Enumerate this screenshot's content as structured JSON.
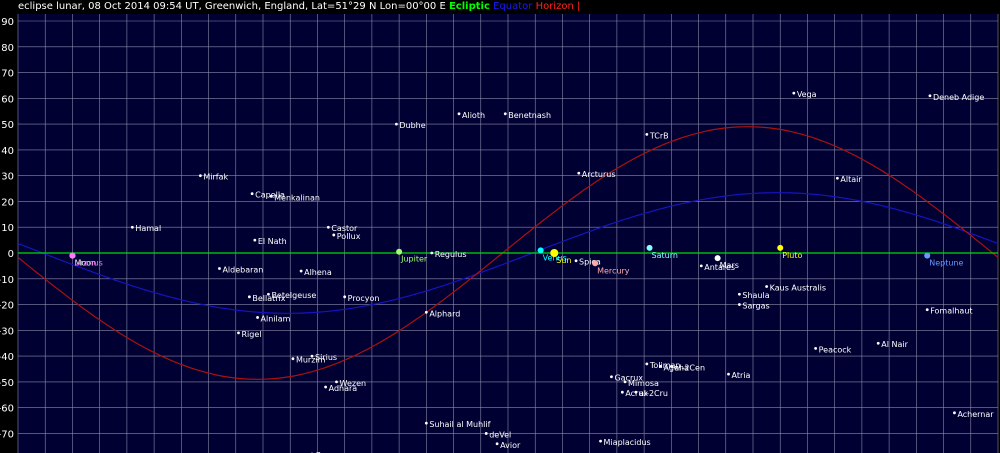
{
  "title": "eclipse lunar, 08 Oct 2014 09:54 UT, Greenwich, England, Lat=51°29 N Lon=00°00 E",
  "legend": {
    "ecliptic": "Ecliptic",
    "equator": "Equator",
    "horizon": "Horizon",
    "separator": "|"
  },
  "colors": {
    "background": "#000033",
    "grid": "#8a8aa8",
    "ecliptic": "#00dd00",
    "equator": "#1515c0",
    "horizon": "#aa1111",
    "star": "#ffffff"
  },
  "chart_data": {
    "type": "scatter",
    "y_ticks": [
      "90",
      "80",
      "70",
      "60",
      "50",
      "40",
      "30",
      "20",
      "10",
      "0",
      "-10",
      "-20",
      "-30",
      "-40",
      "-50",
      "-60",
      "-70"
    ],
    "ylim": [
      -80,
      90
    ],
    "xlim": [
      0,
      360
    ],
    "grid": true,
    "bodies": [
      {
        "name": "Moon",
        "x": 20,
        "y": -1,
        "color": "#ffffff"
      },
      {
        "name": "Uranus",
        "x": 20,
        "y": -1,
        "color": "#ff77ff"
      },
      {
        "name": "Jupiter",
        "x": 140,
        "y": 0.5,
        "color": "#a0ff70"
      },
      {
        "name": "Venus",
        "x": 192,
        "y": 1,
        "color": "#00ffff"
      },
      {
        "name": "Sun",
        "x": 197,
        "y": 0,
        "color": "#ffff00"
      },
      {
        "name": "Mercury",
        "x": 212,
        "y": -4,
        "color": "#ffaaaa"
      },
      {
        "name": "Saturn",
        "x": 232,
        "y": 2,
        "color": "#80ffff"
      },
      {
        "name": "Mars",
        "x": 257,
        "y": -2,
        "color": "#ffffff"
      },
      {
        "name": "Pluto",
        "x": 280,
        "y": 2,
        "color": "#ffff00"
      },
      {
        "name": "Neptune",
        "x": 334,
        "y": -1,
        "color": "#6699ff"
      }
    ],
    "stars": [
      {
        "name": "Hamal",
        "x": 42,
        "y": 10
      },
      {
        "name": "Mirfak",
        "x": 67,
        "y": 30
      },
      {
        "name": "Capella",
        "x": 86,
        "y": 23
      },
      {
        "name": "Menkalinan",
        "x": 93,
        "y": 22
      },
      {
        "name": "El Nath",
        "x": 87,
        "y": 5
      },
      {
        "name": "Aldebaran",
        "x": 74,
        "y": -6
      },
      {
        "name": "Alhena",
        "x": 104,
        "y": -7
      },
      {
        "name": "Castor",
        "x": 114,
        "y": 10
      },
      {
        "name": "Pollux",
        "x": 116,
        "y": 7
      },
      {
        "name": "Bellatrix",
        "x": 85,
        "y": -17
      },
      {
        "name": "Betelgeuse",
        "x": 92,
        "y": -16
      },
      {
        "name": "Alnilam",
        "x": 88,
        "y": -25
      },
      {
        "name": "Procyon",
        "x": 120,
        "y": -17
      },
      {
        "name": "Rigel",
        "x": 81,
        "y": -31
      },
      {
        "name": "Sirius",
        "x": 108,
        "y": -40
      },
      {
        "name": "Murzim",
        "x": 101,
        "y": -41
      },
      {
        "name": "Wezen",
        "x": 117,
        "y": -50
      },
      {
        "name": "Adhara",
        "x": 113,
        "y": -52
      },
      {
        "name": "Canopus",
        "x": 108,
        "y": -78
      },
      {
        "name": "Dubhe",
        "x": 139,
        "y": 50
      },
      {
        "name": "Alioth",
        "x": 162,
        "y": 54
      },
      {
        "name": "Benetnash",
        "x": 179,
        "y": 54
      },
      {
        "name": "Regulus",
        "x": 152,
        "y": 0
      },
      {
        "name": "Alphard",
        "x": 150,
        "y": -23
      },
      {
        "name": "Suhail al Muhlif",
        "x": 150,
        "y": -66
      },
      {
        "name": "deVel",
        "x": 172,
        "y": -70
      },
      {
        "name": "Avior",
        "x": 176,
        "y": -74
      },
      {
        "name": "Arcturus",
        "x": 206,
        "y": 31
      },
      {
        "name": "Spica",
        "x": 205,
        "y": -3
      },
      {
        "name": "Miaplacidus",
        "x": 214,
        "y": -73
      },
      {
        "name": "TCrB",
        "x": 231,
        "y": 46
      },
      {
        "name": "Gacrux",
        "x": 218,
        "y": -48
      },
      {
        "name": "Mimosa",
        "x": 223,
        "y": -50
      },
      {
        "name": "Acrux",
        "x": 222,
        "y": -54
      },
      {
        "name": "al-2Cru",
        "x": 227,
        "y": -54
      },
      {
        "name": "Toliman",
        "x": 231,
        "y": -43
      },
      {
        "name": "Agena",
        "x": 236,
        "y": -44
      },
      {
        "name": "al-2Cen",
        "x": 240,
        "y": -44
      },
      {
        "name": "Antares",
        "x": 251,
        "y": -5
      },
      {
        "name": "Kaus Australis",
        "x": 275,
        "y": -13
      },
      {
        "name": "Shaula",
        "x": 265,
        "y": -16
      },
      {
        "name": "Sargas",
        "x": 265,
        "y": -20
      },
      {
        "name": "Atria",
        "x": 261,
        "y": -47
      },
      {
        "name": "Vega",
        "x": 285,
        "y": 62
      },
      {
        "name": "Altair",
        "x": 301,
        "y": 29
      },
      {
        "name": "Peacock",
        "x": 293,
        "y": -37
      },
      {
        "name": "Al Nair",
        "x": 316,
        "y": -35
      },
      {
        "name": "Deneb Adige",
        "x": 335,
        "y": 61
      },
      {
        "name": "Fomalhaut",
        "x": 334,
        "y": -22
      },
      {
        "name": "Achernar",
        "x": 344,
        "y": -62
      }
    ]
  }
}
